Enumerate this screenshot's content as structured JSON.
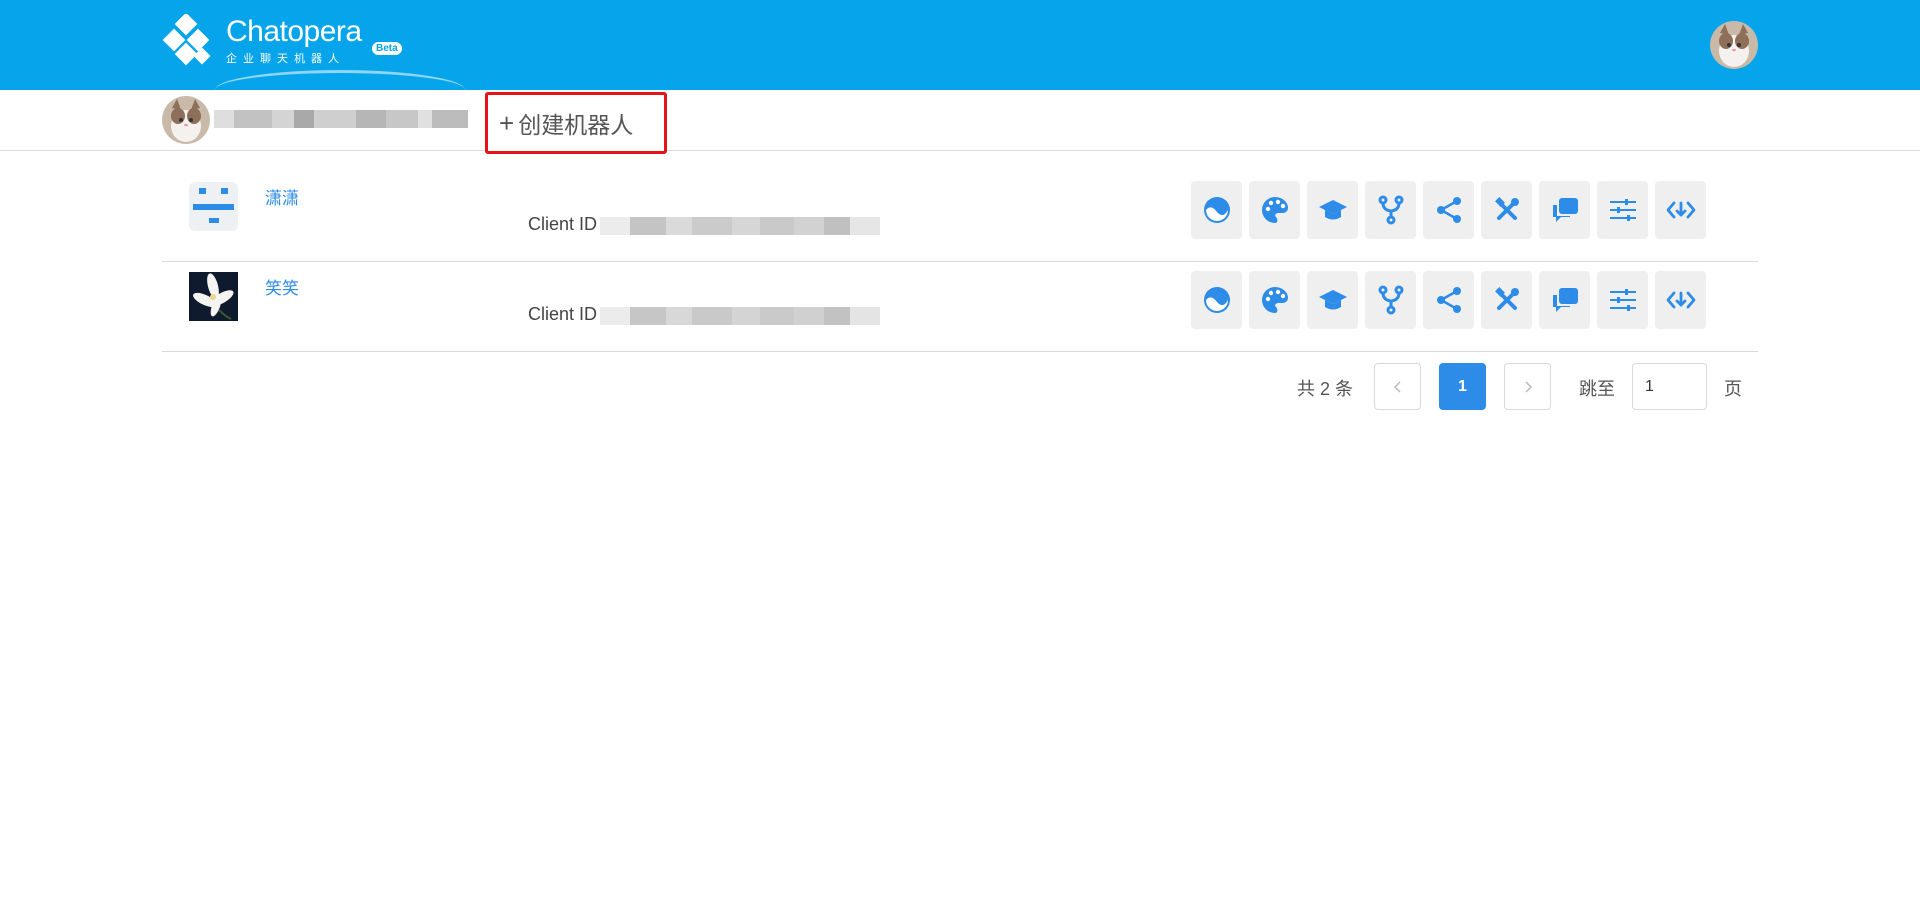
{
  "brand": {
    "title": "Chatopera",
    "subtitle": "企业聊天机器人",
    "badge": "Beta",
    "color": "#06a4ea"
  },
  "header": {
    "avatar_icon": "user-avatar-cat"
  },
  "subheader": {
    "create_button_label": "创建机器人",
    "create_button_icon": "plus",
    "highlight_color": "#e5141b"
  },
  "bots": [
    {
      "name": "潇潇",
      "avatar_icon": "robot-face-avatar",
      "client_id_label": "Client ID"
    },
    {
      "name": "笑笑",
      "avatar_icon": "lily-flower-avatar",
      "client_id_label": "Client ID"
    }
  ],
  "actions": [
    {
      "name": "dashboard",
      "icon": "gauge-icon"
    },
    {
      "name": "palette",
      "icon": "palette-icon"
    },
    {
      "name": "training",
      "icon": "graduation-cap-icon"
    },
    {
      "name": "branch",
      "icon": "fork-icon"
    },
    {
      "name": "share",
      "icon": "share-icon"
    },
    {
      "name": "tools",
      "icon": "tools-icon"
    },
    {
      "name": "conversations",
      "icon": "chat-bubbles-icon"
    },
    {
      "name": "settings",
      "icon": "sliders-icon"
    },
    {
      "name": "integration",
      "icon": "code-icon"
    }
  ],
  "pagination": {
    "total_text": "共 2 条",
    "prev": "<",
    "current_page": "1",
    "next": ">",
    "jump_label": "跳至",
    "jump_value": "1",
    "page_suffix": "页",
    "accent": "#2d8ce8"
  }
}
